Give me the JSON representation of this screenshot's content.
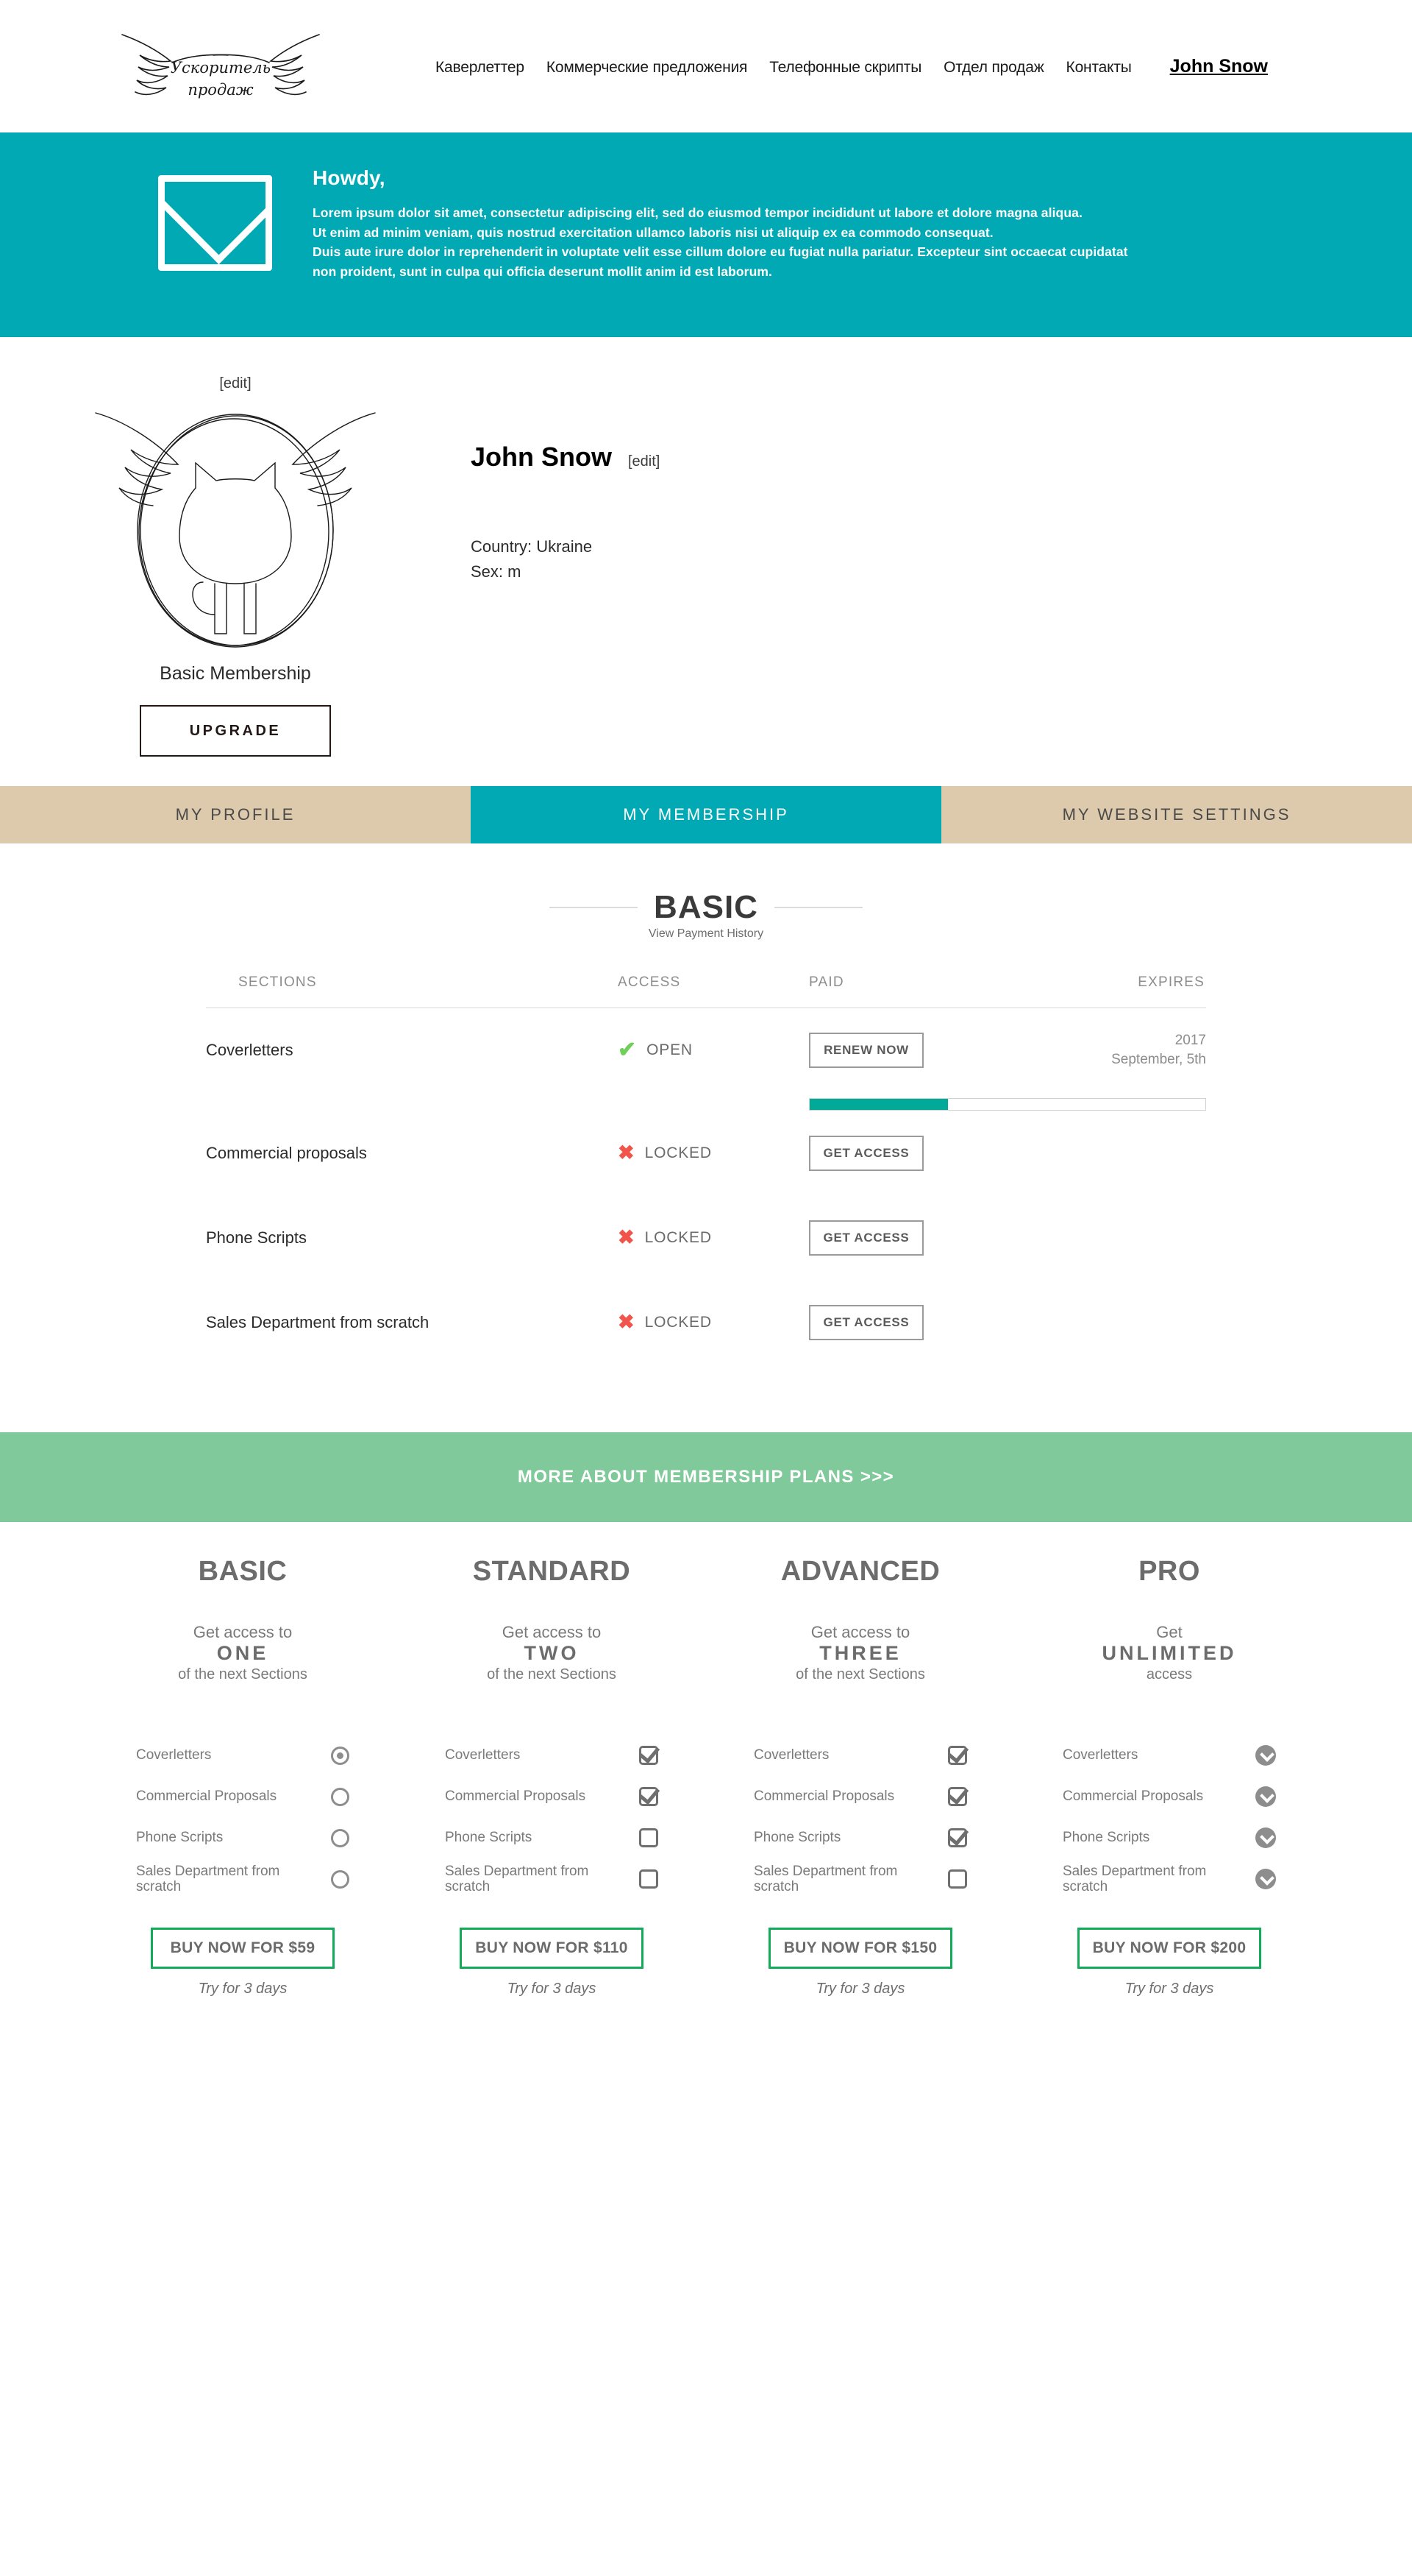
{
  "header": {
    "logo_text_top": "Ускоритель",
    "logo_text_bottom": "продаж",
    "nav": [
      {
        "label": "Каверлеттер"
      },
      {
        "label": "Коммерческие предложения"
      },
      {
        "label": "Телефонные скрипты"
      },
      {
        "label": "Отдел продаж"
      },
      {
        "label": "Контакты"
      }
    ],
    "user": "John Snow"
  },
  "banner": {
    "icon": "envelope-icon",
    "title": "Howdy,",
    "paragraphs": [
      "Lorem ipsum dolor sit amet, consectetur adipiscing elit, sed do eiusmod tempor incididunt ut labore et dolore magna aliqua.",
      "Ut enim ad minim veniam, quis nostrud exercitation ullamco laboris nisi ut aliquip ex ea commodo consequat.",
      "Duis aute irure dolor in reprehenderit in voluptate velit esse cillum dolore eu fugiat nulla pariatur. Excepteur sint occaecat cupidatat",
      "non proident, sunt in culpa qui officia deserunt mollit anim id est laborum."
    ]
  },
  "profile": {
    "avatar_edit": "[edit]",
    "membership_label": "Basic Membership",
    "upgrade_label": "UPGRADE",
    "name": "John Snow",
    "name_edit": "[edit]",
    "country": "Country: Ukraine",
    "sex": "Sex: m"
  },
  "tabs": [
    {
      "label": "MY PROFILE",
      "active": false
    },
    {
      "label": "MY MEMBERSHIP",
      "active": true
    },
    {
      "label": "MY WEBSITE SETTINGS",
      "active": false
    }
  ],
  "membership": {
    "plan_title": "BASIC",
    "payment_history_label": "View Payment History",
    "columns": [
      "SECTIONS",
      "ACCESS",
      "PAID",
      "EXPIRES"
    ],
    "rows": [
      {
        "section": "Coverletters",
        "access": "OPEN",
        "access_icon": "check-icon",
        "button": "RENEW NOW",
        "expires_year": "2017",
        "expires_date": "September, 5th",
        "progress_percent": 35
      },
      {
        "section": "Commercial proposals",
        "access": "LOCKED",
        "access_icon": "cross-icon",
        "button": "GET ACCESS",
        "expires_year": "",
        "expires_date": "",
        "progress_percent": null
      },
      {
        "section": "Phone Scripts",
        "access": "LOCKED",
        "access_icon": "cross-icon",
        "button": "GET ACCESS",
        "expires_year": "",
        "expires_date": "",
        "progress_percent": null
      },
      {
        "section": "Sales Department from scratch",
        "access": "LOCKED",
        "access_icon": "cross-icon",
        "button": "GET ACCESS",
        "expires_year": "",
        "expires_date": "",
        "progress_percent": null
      }
    ]
  },
  "more_bar": {
    "label": "MORE ABOUT MEMBERSHIP PLANS >>>"
  },
  "pricing": {
    "try_note": "Try for 3 days",
    "plans": [
      {
        "name": "BASIC",
        "sub_top": "Get access to",
        "sub_big": "ONE",
        "sub_bottom": "of the next Sections",
        "control": "radio",
        "features": [
          {
            "label": "Coverletters",
            "on": true
          },
          {
            "label": "Commercial Proposals",
            "on": false
          },
          {
            "label": "Phone Scripts",
            "on": false
          },
          {
            "label": "Sales Department from scratch",
            "on": false
          }
        ],
        "buy_label": "BUY NOW FOR $59",
        "price": 59
      },
      {
        "name": "STANDARD",
        "sub_top": "Get access to",
        "sub_big": "TWO",
        "sub_bottom": "of the next Sections",
        "control": "checkbox",
        "features": [
          {
            "label": "Coverletters",
            "on": true
          },
          {
            "label": "Commercial Proposals",
            "on": true
          },
          {
            "label": "Phone Scripts",
            "on": false
          },
          {
            "label": "Sales Department from scratch",
            "on": false
          }
        ],
        "buy_label": "BUY NOW FOR $110",
        "price": 110
      },
      {
        "name": "ADVANCED",
        "sub_top": "Get access to",
        "sub_big": "THREE",
        "sub_bottom": "of the next Sections",
        "control": "checkbox",
        "features": [
          {
            "label": "Coverletters",
            "on": true
          },
          {
            "label": "Commercial Proposals",
            "on": true
          },
          {
            "label": "Phone Scripts",
            "on": true
          },
          {
            "label": "Sales Department from scratch",
            "on": false
          }
        ],
        "buy_label": "BUY NOW FOR $150",
        "price": 150
      },
      {
        "name": "PRO",
        "sub_top": "Get",
        "sub_big": "UNLIMITED",
        "sub_bottom": "access",
        "control": "chevron",
        "features": [
          {
            "label": "Coverletters",
            "on": true
          },
          {
            "label": "Commercial Proposals",
            "on": true
          },
          {
            "label": "Phone Scripts",
            "on": true
          },
          {
            "label": "Sales Department from scratch",
            "on": true
          }
        ],
        "buy_label": "BUY NOW FOR $200",
        "price": 200
      }
    ]
  },
  "colors": {
    "teal": "#00a9b4",
    "tab_inactive": "#ddcaad",
    "green_bar": "#7fc99a",
    "progress": "#00a998",
    "buy_border": "#12ab5a",
    "check_green": "#6fcf5a",
    "cross_red": "#f1544a"
  }
}
